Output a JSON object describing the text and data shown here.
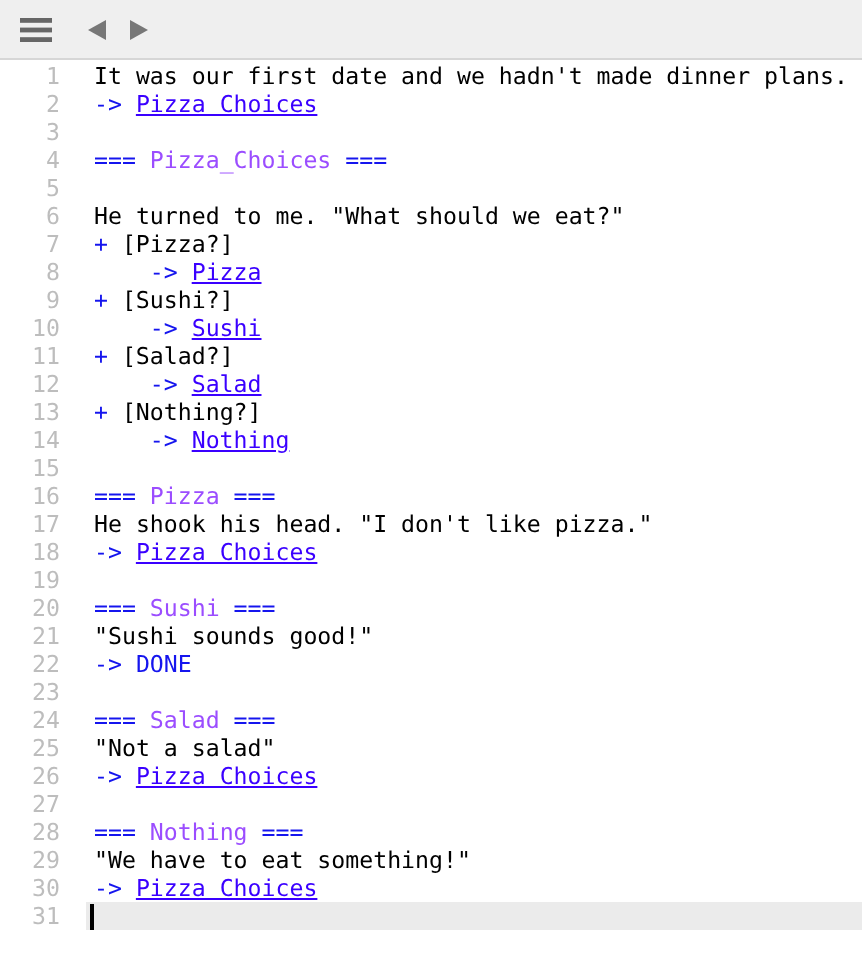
{
  "toolbar": {
    "buttons": [
      {
        "kind": "menu",
        "disabled": false
      },
      {
        "kind": "back",
        "disabled": false
      },
      {
        "kind": "forward",
        "disabled": false
      }
    ]
  },
  "editor": {
    "lines": [
      {
        "number": "1",
        "indented": false,
        "current": false,
        "segments": [
          {
            "kind": "plain",
            "text": "It was our first date and we hadn't made dinner plans."
          }
        ]
      },
      {
        "number": "2",
        "indented": false,
        "current": false,
        "segments": [
          {
            "kind": "arrow",
            "text": "->"
          },
          {
            "kind": "link",
            "text": "Pizza Choices"
          }
        ]
      },
      {
        "number": "3",
        "current": false
      },
      {
        "number": "4",
        "indented": false,
        "current": false,
        "segments": [
          {
            "kind": "knot-mark",
            "text": "==="
          },
          {
            "kind": "knot-name",
            "text": "Pizza_Choices"
          },
          {
            "kind": "knot-mark",
            "text": "==="
          }
        ]
      },
      {
        "number": "5",
        "current": false
      },
      {
        "number": "6",
        "indented": false,
        "current": false,
        "segments": [
          {
            "kind": "plain",
            "text": "He turned to me. \"What should we eat?\""
          }
        ]
      },
      {
        "number": "7",
        "indented": false,
        "current": false,
        "segments": [
          {
            "kind": "choice-mark",
            "text": "+"
          },
          {
            "kind": "plain",
            "text": "[Pizza?]"
          }
        ]
      },
      {
        "number": "8",
        "indented": true,
        "current": false,
        "segments": [
          {
            "kind": "arrow",
            "text": "->"
          },
          {
            "kind": "link",
            "text": "Pizza"
          }
        ]
      },
      {
        "number": "9",
        "indented": false,
        "current": false,
        "segments": [
          {
            "kind": "choice-mark",
            "text": "+"
          },
          {
            "kind": "plain",
            "text": "[Sushi?]"
          }
        ]
      },
      {
        "number": "10",
        "indented": true,
        "current": false,
        "segments": [
          {
            "kind": "arrow",
            "text": "->"
          },
          {
            "kind": "link",
            "text": "Sushi"
          }
        ]
      },
      {
        "number": "11",
        "indented": false,
        "current": false,
        "segments": [
          {
            "kind": "choice-mark",
            "text": "+"
          },
          {
            "kind": "plain",
            "text": "[Salad?]"
          }
        ]
      },
      {
        "number": "12",
        "indented": true,
        "current": false,
        "segments": [
          {
            "kind": "arrow",
            "text": "->"
          },
          {
            "kind": "link",
            "text": "Salad"
          }
        ]
      },
      {
        "number": "13",
        "indented": false,
        "current": false,
        "segments": [
          {
            "kind": "choice-mark",
            "text": "+"
          },
          {
            "kind": "plain",
            "text": "[Nothing?]"
          }
        ]
      },
      {
        "number": "14",
        "indented": true,
        "current": false,
        "segments": [
          {
            "kind": "arrow",
            "text": "->"
          },
          {
            "kind": "link",
            "text": "Nothing"
          }
        ]
      },
      {
        "number": "15",
        "current": false
      },
      {
        "number": "16",
        "indented": false,
        "current": false,
        "segments": [
          {
            "kind": "knot-mark",
            "text": "==="
          },
          {
            "kind": "knot-name",
            "text": "Pizza"
          },
          {
            "kind": "knot-mark",
            "text": "==="
          }
        ]
      },
      {
        "number": "17",
        "indented": false,
        "current": false,
        "segments": [
          {
            "kind": "plain",
            "text": "He shook his head. \"I don't like pizza.\""
          }
        ]
      },
      {
        "number": "18",
        "indented": false,
        "current": false,
        "segments": [
          {
            "kind": "arrow",
            "text": "->"
          },
          {
            "kind": "link",
            "text": "Pizza Choices"
          }
        ]
      },
      {
        "number": "19",
        "current": false
      },
      {
        "number": "20",
        "indented": false,
        "current": false,
        "segments": [
          {
            "kind": "knot-mark",
            "text": "==="
          },
          {
            "kind": "knot-name",
            "text": "Sushi"
          },
          {
            "kind": "knot-mark",
            "text": "==="
          }
        ]
      },
      {
        "number": "21",
        "indented": false,
        "current": false,
        "segments": [
          {
            "kind": "plain",
            "text": "\"Sushi sounds good!\""
          }
        ]
      },
      {
        "number": "22",
        "indented": false,
        "current": false,
        "segments": [
          {
            "kind": "arrow",
            "text": "->"
          },
          {
            "kind": "divert",
            "text": "DONE"
          }
        ]
      },
      {
        "number": "23",
        "current": false
      },
      {
        "number": "24",
        "indented": false,
        "current": false,
        "segments": [
          {
            "kind": "knot-mark",
            "text": "==="
          },
          {
            "kind": "knot-name",
            "text": "Salad"
          },
          {
            "kind": "knot-mark",
            "text": "==="
          }
        ]
      },
      {
        "number": "25",
        "indented": false,
        "current": false,
        "segments": [
          {
            "kind": "plain",
            "text": "\"Not a salad\""
          }
        ]
      },
      {
        "number": "26",
        "indented": false,
        "current": false,
        "segments": [
          {
            "kind": "arrow",
            "text": "->"
          },
          {
            "kind": "link",
            "text": "Pizza Choices"
          }
        ]
      },
      {
        "number": "27",
        "current": false
      },
      {
        "number": "28",
        "indented": false,
        "current": false,
        "segments": [
          {
            "kind": "knot-mark",
            "text": "==="
          },
          {
            "kind": "knot-name",
            "text": "Nothing"
          },
          {
            "kind": "knot-mark",
            "text": "==="
          }
        ]
      },
      {
        "number": "29",
        "indented": false,
        "current": false,
        "segments": [
          {
            "kind": "plain",
            "text": "\"We have to eat something!\""
          }
        ]
      },
      {
        "number": "30",
        "indented": false,
        "current": false,
        "segments": [
          {
            "kind": "arrow",
            "text": "->"
          },
          {
            "kind": "link",
            "text": "Pizza Choices"
          }
        ]
      },
      {
        "number": "31",
        "current": true
      }
    ]
  }
}
